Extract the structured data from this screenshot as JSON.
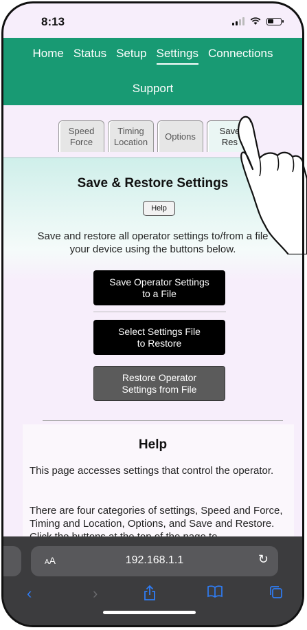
{
  "status_bar": {
    "time": "8:13"
  },
  "nav": {
    "row1": [
      "Home",
      "Status",
      "Setup",
      "Settings",
      "Connections"
    ],
    "row2": [
      "Support"
    ],
    "active": "Settings"
  },
  "tabs": [
    {
      "line1": "Speed",
      "line2": "Force"
    },
    {
      "line1": "Timing",
      "line2": "Location"
    },
    {
      "line1": "Options",
      "line2": ""
    },
    {
      "line1": "Save",
      "line2": "Res"
    }
  ],
  "main": {
    "title": "Save & Restore Settings",
    "help_button": "Help",
    "description_line1": "Save and restore all operator settings to/from a file",
    "description_line2": "your device using the buttons below.",
    "save_button_l1": "Save Operator Settings",
    "save_button_l2": "to a File",
    "select_button_l1": "Select Settings File",
    "select_button_l2": "to Restore",
    "restore_button_l1": "Restore Operator",
    "restore_button_l2": "Settings from File"
  },
  "help": {
    "heading": "Help",
    "p1": "This page accesses settings that control the operator.",
    "p2": "There are four categories of settings, Speed and Force, Timing and Location, Options, and Save and Restore. Click the buttons at the top of the page to"
  },
  "safari": {
    "aa_label_small": "A",
    "aa_label": "A",
    "url": "192.168.1.1"
  },
  "colors": {
    "nav_green": "#189a73",
    "page_bg": "#f7eefb",
    "safari_bar": "#3c3c3e",
    "safari_accent": "#2f7df6"
  }
}
